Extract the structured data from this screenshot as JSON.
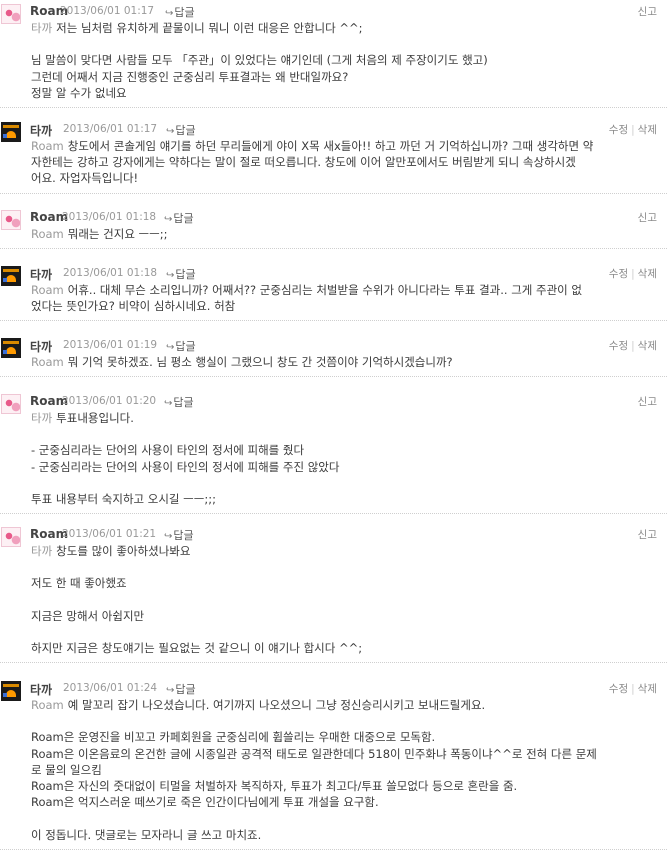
{
  "reply_label": "답글",
  "report_label": "신고",
  "edit_label": "수정",
  "delete_label": "삭제",
  "comments": [
    {
      "author": "Roam",
      "date": "2013/06/01 01:17",
      "mention": "타까",
      "lines": [
        "저는 님처럼 유치하게 끝물이니 뭐니 이런 대응은 안합니다 ^^;",
        "",
        "님 말씀이 맞다면 사람들 모두 「주관」이 있었다는 얘기인데 (그게 처음의 제 주장이기도 했고)",
        "그런데 어째서 지금 진행중인 군중심리 투표결과는 왜 반대일까요?",
        "정말 알 수가 없네요"
      ]
    },
    {
      "author": "타까",
      "date": "2013/06/01 01:17",
      "mention": "Roam",
      "lines": [
        "창도에서 콘솔게임 얘기를 하던 무리들에게 야이 X목 새x들아!! 하고 까던 거 기억하십니까? 그때 생각하면 약",
        "자한테는 강하고 강자에게는 약하다는 말이 절로 떠오릅니다. 창도에 이어 알만포에서도 버림받게 되니 속상하시겠",
        "어요. 자업자득입니다!"
      ]
    },
    {
      "author": "Roam",
      "date": "2013/06/01 01:18",
      "mention": "Roam",
      "lines": [
        "뭐래는 건지요 ㅡㅡ;;"
      ]
    },
    {
      "author": "타까",
      "date": "2013/06/01 01:18",
      "mention": "Roam",
      "lines": [
        "어휴.. 대체 무슨 소리입니까? 어째서?? 군중심리는 처벌받을 수위가 아니다라는 투표 결과.. 그게 주관이 없",
        "었다는 뜻인가요? 비약이 심하시네요. 허참"
      ]
    },
    {
      "author": "타까",
      "date": "2013/06/01 01:19",
      "mention": "Roam",
      "lines": [
        "뭐 기억 못하겠죠. 님 평소 행실이 그랬으니 창도 간 것쯤이야 기억하시겠습니까?"
      ]
    },
    {
      "author": "Roam",
      "date": "2013/06/01 01:20",
      "mention": "타까",
      "lines": [
        "투표내용입니다.",
        "",
        "- 군중심리라는 단어의 사용이 타인의 정서에 피해를 줬다",
        "- 군중심리라는 단어의 사용이 타인의 정서에 피해를 주진 않았다",
        "",
        "투표 내용부터 숙지하고 오시길 ㅡㅡ;;;"
      ]
    },
    {
      "author": "Roam",
      "date": "2013/06/01 01:21",
      "mention": "타까",
      "lines": [
        "창도를 많이 좋아하셨나봐요",
        "",
        "저도 한 때 좋아했죠",
        "",
        "지금은 망해서 아쉽지만",
        "",
        "하지만 지금은 창도얘기는 필요없는 것 같으니 이 얘기나 합시다 ^^;"
      ]
    },
    {
      "author": "타까",
      "date": "2013/06/01 01:24",
      "mention": "Roam",
      "lines": [
        "예 말꼬리 잡기 나오셨습니다. 여기까지 나오셨으니 그냥 정신승리시키고 보내드릴게요.",
        "",
        "Roam은 운영진을 비꼬고 카페회원을 군중심리에 휩쓸리는 우매한 대중으로 모독함.",
        "Roam은 이온음료의 온건한 글에 시종일관 공격적 태도로 일관한데다 518이 민주화냐 폭동이냐^^로 전혀 다른 문제",
        "로 물의 일으킴",
        "Roam은 자신의 줏대없이 티멀을 처벌하자 복직하자, 투표가 최고다/투표 쓸모없다 등으로 혼란을 줌.",
        "Roam은 억지스러운 떼쓰기로 죽은 인간이다님에게 투표 개설을 요구함.",
        "",
        "이 정돕니다. 댓글로는 모자라니 글 쓰고 마치죠."
      ]
    }
  ]
}
